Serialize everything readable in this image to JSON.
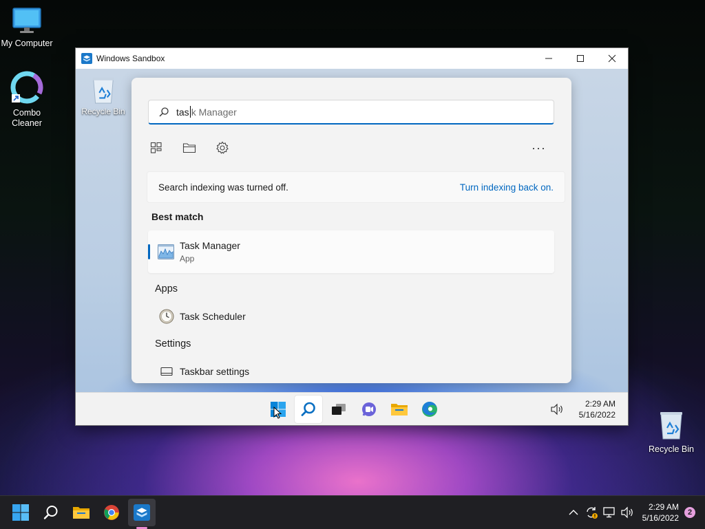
{
  "desktop": {
    "icons": [
      {
        "label": "My Computer"
      },
      {
        "label": "Combo Cleaner"
      },
      {
        "label": "Recycle Bin"
      }
    ]
  },
  "sandbox": {
    "title": "Windows Sandbox",
    "controls": {
      "minimize": "—",
      "maximize": "☐",
      "close": "✕"
    },
    "desktop_icon": {
      "label": "Recycle Bin"
    },
    "search": {
      "typed": "tas",
      "suggestion_rest": "k Manager",
      "more": "···",
      "notice": {
        "message": "Search indexing was turned off.",
        "link": "Turn indexing back on."
      },
      "best_match": {
        "heading": "Best match",
        "name_bold": "Task",
        "name_rest": " Manager",
        "kind": "App"
      },
      "apps": {
        "heading": "Apps",
        "items": [
          {
            "bold": "Task",
            "rest": " Scheduler"
          }
        ]
      },
      "settings": {
        "heading": "Settings",
        "items": [
          {
            "bold": "Task",
            "rest": "bar settings"
          }
        ]
      }
    },
    "taskbar": {
      "time": "2:29 AM",
      "date": "5/16/2022"
    }
  },
  "host_taskbar": {
    "time": "2:29 AM",
    "date": "5/16/2022",
    "notification_count": "2"
  },
  "colors": {
    "accent": "#0067c0",
    "badge": "#e6a0de"
  }
}
